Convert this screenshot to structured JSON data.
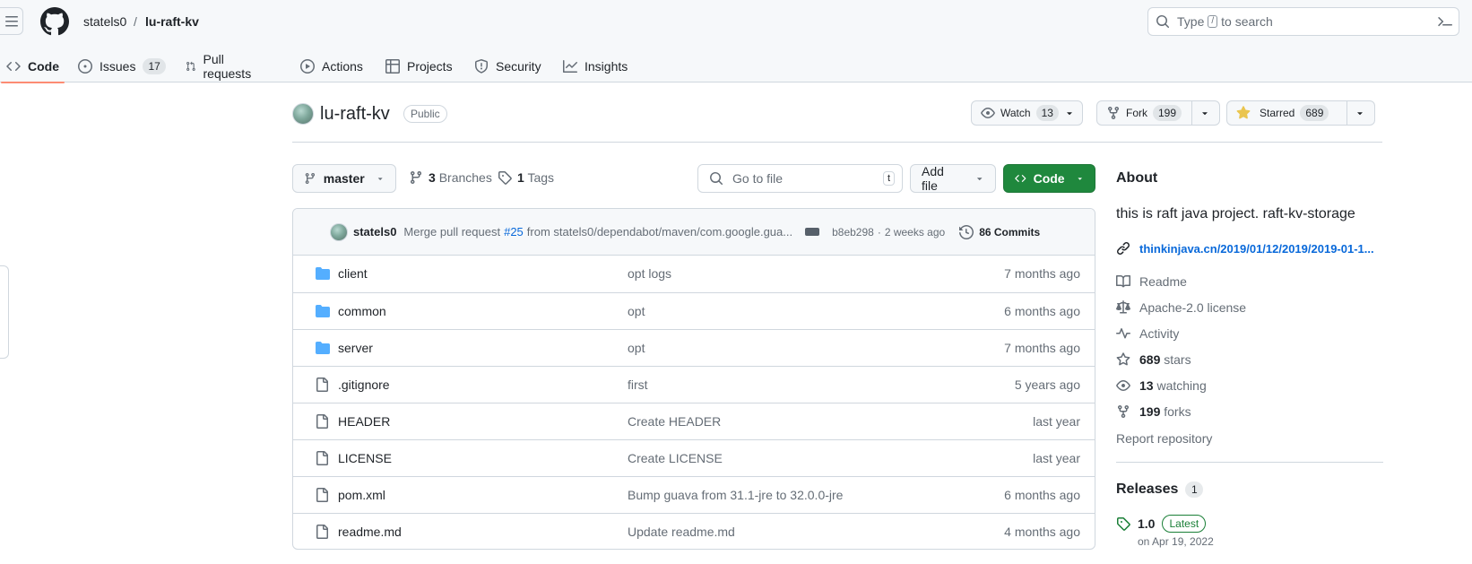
{
  "header": {
    "owner": "statels0",
    "separator": "/",
    "repo": "lu-raft-kv",
    "search": {
      "pre": "Type",
      "key": "/",
      "post": "to search"
    }
  },
  "tabs": [
    {
      "label": "Code",
      "icon": "code-icon",
      "selected": true
    },
    {
      "label": "Issues",
      "icon": "issue-opened-icon",
      "count": "17"
    },
    {
      "label": "Pull requests",
      "icon": "git-pull-request-icon"
    },
    {
      "label": "Actions",
      "icon": "play-icon"
    },
    {
      "label": "Projects",
      "icon": "table-icon"
    },
    {
      "label": "Security",
      "icon": "shield-icon"
    },
    {
      "label": "Insights",
      "icon": "graph-icon"
    }
  ],
  "repo": {
    "name": "lu-raft-kv",
    "visibility": "Public",
    "watch": {
      "label": "Watch",
      "count": "13"
    },
    "fork": {
      "label": "Fork",
      "count": "199"
    },
    "star": {
      "label": "Starred",
      "count": "689"
    }
  },
  "filenav": {
    "branch": "master",
    "branches": {
      "count": "3",
      "label": "Branches"
    },
    "tags": {
      "count": "1",
      "label": "Tags"
    },
    "goto_placeholder": "Go to file",
    "goto_key": "t",
    "add_file": "Add file",
    "code": "Code"
  },
  "commit": {
    "author": "statels0",
    "message_pre": "Merge pull request",
    "pr": "#25",
    "message_post": "from statels0/dependabot/maven/com.google.gua...",
    "sha": "b8eb298",
    "dot": "·",
    "when": "2 weeks ago",
    "commits": "86 Commits"
  },
  "files": [
    {
      "name": "client",
      "type": "dir",
      "message": "opt logs",
      "age": "7 months ago"
    },
    {
      "name": "common",
      "type": "dir",
      "message": "opt",
      "age": "6 months ago"
    },
    {
      "name": "server",
      "type": "dir",
      "message": "opt",
      "age": "7 months ago"
    },
    {
      "name": ".gitignore",
      "type": "file",
      "message": "first",
      "age": "5 years ago"
    },
    {
      "name": "HEADER",
      "type": "file",
      "message": "Create HEADER",
      "age": "last year"
    },
    {
      "name": "LICENSE",
      "type": "file",
      "message": "Create LICENSE",
      "age": "last year"
    },
    {
      "name": "pom.xml",
      "type": "file",
      "message": "Bump guava from 31.1-jre to 32.0.0-jre",
      "age": "6 months ago"
    },
    {
      "name": "readme.md",
      "type": "file",
      "message": "Update readme.md",
      "age": "4 months ago"
    }
  ],
  "about": {
    "title": "About",
    "description": "this is raft java project. raft-kv-storage",
    "link": "thinkinjava.cn/2019/01/12/2019/2019-01-1...",
    "readme": "Readme",
    "license": "Apache-2.0 license",
    "activity": "Activity",
    "stars": {
      "count": "689",
      "label": "stars"
    },
    "watching": {
      "count": "13",
      "label": "watching"
    },
    "forks": {
      "count": "199",
      "label": "forks"
    },
    "report": "Report repository"
  },
  "releases": {
    "title": "Releases",
    "count": "1",
    "tag": "1.0",
    "latest": "Latest",
    "date": "on Apr 19, 2022"
  },
  "colors": {
    "accent_green": "#1f883d",
    "link_blue": "#0969da",
    "folder_blue": "#54aeff",
    "tab_underline": "#fd8c73",
    "star_yellow": "#eac54f"
  }
}
